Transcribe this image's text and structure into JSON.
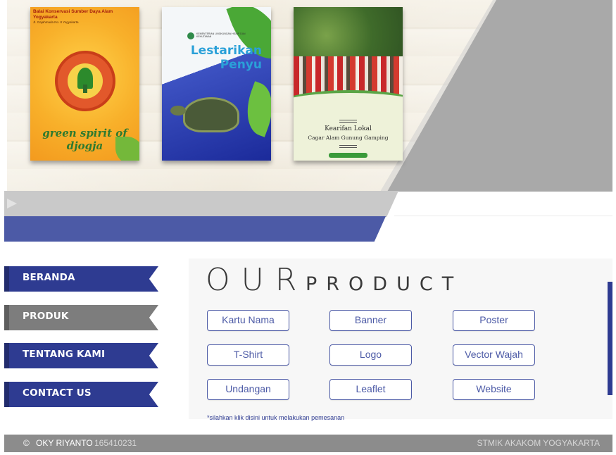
{
  "hero": {
    "cover1": {
      "title": "Balai Konservasi Sumber Daya Alam Yogyakarta",
      "address": "Jl. Gajahmada No. 8 Yogyakarta",
      "tagline": "green spirit of djogja"
    },
    "cover2": {
      "agency": "KEMENTERIAN LINGKUNGAN HIDUP DAN KEHUTANAN",
      "title_line1": "Lestarikan",
      "title_line2": "Penyu"
    },
    "cover3": {
      "title_line1": "Kearifan Lokal",
      "title_line2": "Cagar Alam Gunung Gamping"
    }
  },
  "sidebar": {
    "items": [
      {
        "label": "BERANDA"
      },
      {
        "label": "PRODUK"
      },
      {
        "label": "TENTANG KAMI"
      },
      {
        "label": "CONTACT US"
      }
    ]
  },
  "product": {
    "title_big": "OUR",
    "title_small": "PRODUCT",
    "buttons": [
      {
        "label": "Kartu Nama"
      },
      {
        "label": "Banner"
      },
      {
        "label": "Poster"
      },
      {
        "label": "T-Shirt"
      },
      {
        "label": "Logo"
      },
      {
        "label": "Vector Wajah"
      },
      {
        "label": "Undangan"
      },
      {
        "label": "Leaflet"
      },
      {
        "label": "Website"
      }
    ],
    "order_note": "*silahkan klik disini untuk melakukan pemesanan"
  },
  "footer": {
    "copyright_symbol": "©",
    "name": "OKY RIYANTO",
    "nim": "165410231",
    "institution": "STMIK AKAKOM YOGYAKARTA"
  },
  "colors": {
    "accent_blue": "#2e3b91",
    "stripe_blue": "#4c5aa6",
    "nav_gray": "#7d7d7d",
    "footer_gray": "#8c8c8c"
  }
}
